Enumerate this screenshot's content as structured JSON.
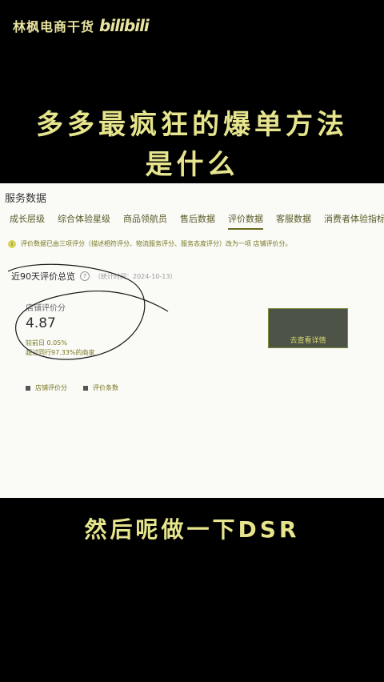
{
  "brand": {
    "name": "林枫电商干货",
    "logo": "bilibili"
  },
  "headline": {
    "line1": "多多最疯狂的爆单方法",
    "line2": "是什么"
  },
  "panel": {
    "title": "服务数据",
    "tabs": [
      "成长层级",
      "综合体验星级",
      "商品领航员",
      "售后数据",
      "评价数据",
      "客服数据",
      "消费者体验指标"
    ],
    "active_tab": "评价数据",
    "notice": "评价数据已由三项评分（描述相符评分、物流服务评分、服务态度评分）改为一项 店铺评价分。",
    "section_title": "近90天评价总览",
    "stat_date": "（统计时间：2024-10-13）",
    "metric": {
      "label": "店铺评价分",
      "value": "4.87",
      "compare": "较前日  0.05%",
      "rank": "超过同行97.33%的商家"
    },
    "action_button": "去查看详情",
    "legend": [
      "店铺评价分",
      "评价条数"
    ]
  },
  "caption": "然后呢做一下DSR"
}
